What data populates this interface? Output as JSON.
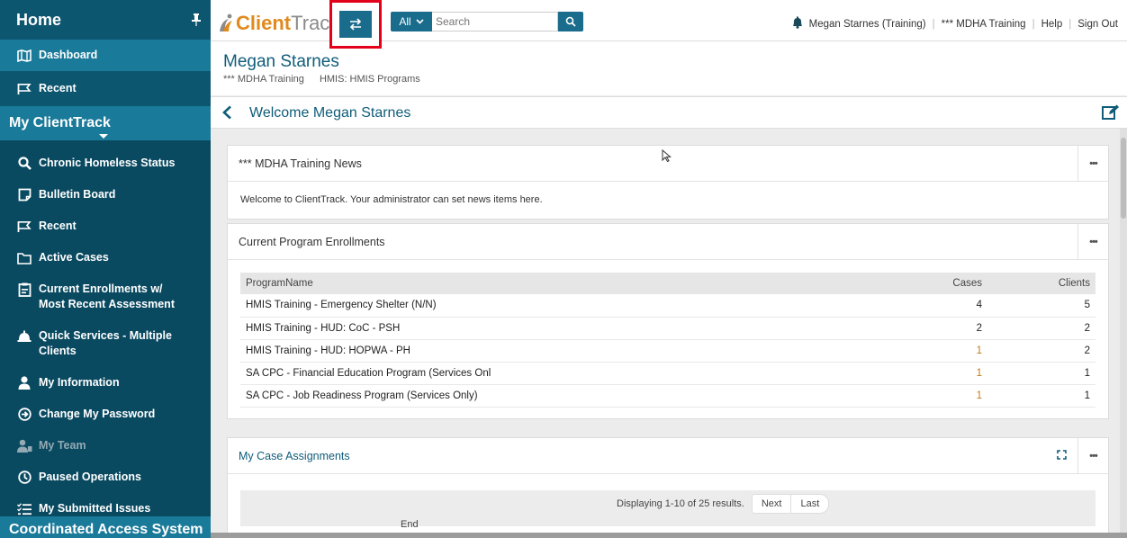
{
  "sidebar": {
    "home_title": "Home",
    "top_items": [
      {
        "label": "Dashboard",
        "icon": "map-icon",
        "active": true
      },
      {
        "label": "Recent",
        "icon": "flag-icon"
      }
    ],
    "section_title": "My ClientTrack",
    "items": [
      {
        "label": "Chronic Homeless Status",
        "icon": "search-icon"
      },
      {
        "label": "Bulletin Board",
        "icon": "note-icon"
      },
      {
        "label": "Recent",
        "icon": "flag-icon"
      },
      {
        "label": "Active Cases",
        "icon": "folder-icon"
      },
      {
        "label": "Current Enrollments w/ Most Recent Assessment",
        "line1": "Current Enrollments w/",
        "line2": "Most Recent Assessment",
        "icon": "clipboard-icon"
      },
      {
        "label": "Quick Services - Multiple Clients",
        "line1": "Quick Services - Multiple",
        "line2": "Clients",
        "icon": "service-bell-icon"
      },
      {
        "label": "My Information",
        "icon": "user-icon"
      },
      {
        "label": "Change My Password",
        "icon": "circle-arrow-icon"
      },
      {
        "label": "My Team",
        "icon": "team-icon",
        "disabled": true
      },
      {
        "label": "Paused Operations",
        "icon": "clock-icon"
      },
      {
        "label": "My Submitted Issues",
        "icon": "checklist-icon"
      }
    ],
    "bottom_section": "Coordinated Access System"
  },
  "topbar": {
    "logo_part1": "Client",
    "logo_part2": "Track",
    "switch_icon": "switch-arrows-icon",
    "search_scope": "All",
    "search_placeholder": "Search",
    "user_link": "Megan Starnes (Training)",
    "org_link": "*** MDHA Training",
    "help": "Help",
    "sign_out": "Sign Out"
  },
  "header": {
    "name": "Megan Starnes",
    "org": "*** MDHA Training",
    "program": "HMIS: HMIS Programs"
  },
  "welcome": {
    "title": "Welcome Megan Starnes"
  },
  "news": {
    "title": "*** MDHA Training News",
    "body": "Welcome to ClientTrack. Your administrator can set news items here."
  },
  "enrollments": {
    "title": "Current Program Enrollments",
    "columns": [
      "ProgramName",
      "Cases",
      "Clients"
    ],
    "rows": [
      {
        "program": "HMIS Training - Emergency Shelter (N/N)",
        "cases": "4",
        "clients": "5"
      },
      {
        "program": "HMIS Training - HUD: CoC - PSH",
        "cases": "2",
        "clients": "2"
      },
      {
        "program": "HMIS Training - HUD: HOPWA - PH",
        "cases": "1",
        "clients": "2"
      },
      {
        "program": "SA CPC - Financial Education Program (Services Onl",
        "cases": "1",
        "clients": "1"
      },
      {
        "program": "SA CPC - Job Readiness Program (Services Only)",
        "cases": "1",
        "clients": "1"
      }
    ]
  },
  "case_assignments": {
    "title": "My Case Assignments",
    "pager_text": "Displaying 1-10 of 25 results.",
    "next": "Next",
    "last": "Last",
    "col_partial": "End"
  },
  "colors": {
    "sidebar": "#0d5670",
    "sidebar_accent": "#1a7a9a",
    "brand_orange": "#e08a1e",
    "primary": "#1a6c8c",
    "highlight": "#e2001a"
  }
}
